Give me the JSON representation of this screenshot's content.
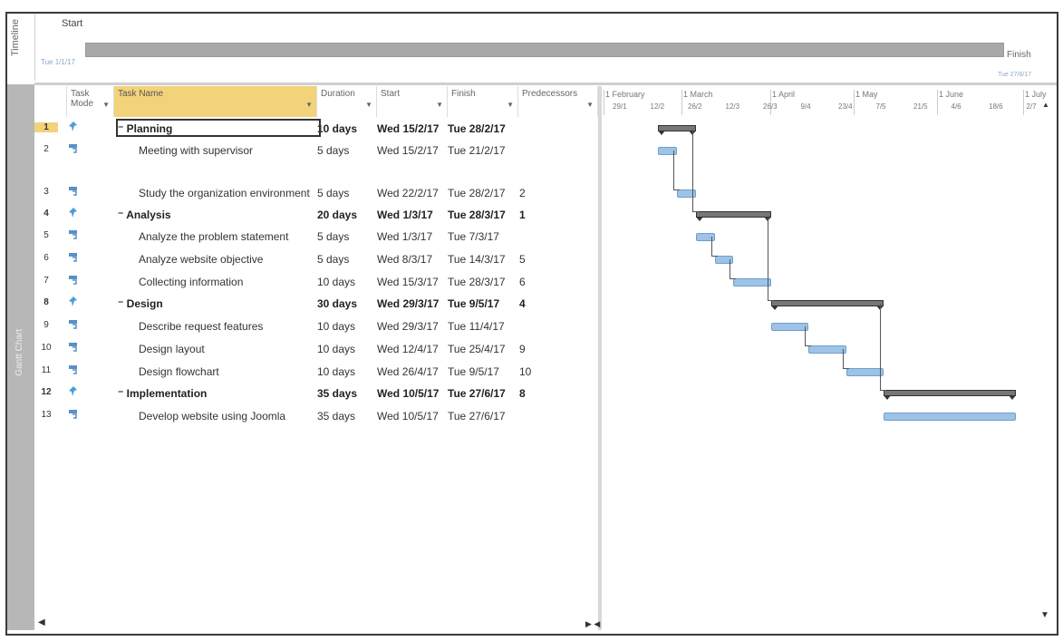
{
  "timeline": {
    "side_label": "Timeline",
    "start_label": "Start",
    "start_date": "Tue 1/1/17",
    "finish_label": "Finish",
    "finish_date": "Tue 27/6/17"
  },
  "gantt_side_label": "Gantt Chart",
  "columns": {
    "task_mode": "Task Mode",
    "task_name": "Task Name",
    "duration": "Duration",
    "start": "Start",
    "finish": "Finish",
    "predecessors": "Predecessors"
  },
  "timescale": {
    "months": [
      "1 February",
      "1 March",
      "1 April",
      "1 May",
      "1 June",
      "1 July"
    ],
    "weeks": [
      "29/1",
      "12/2",
      "26/2",
      "12/3",
      "26/3",
      "9/4",
      "23/4",
      "7/5",
      "21/5",
      "4/6",
      "18/6",
      "2/7"
    ]
  },
  "tasks": [
    {
      "id": "1",
      "name": "Planning",
      "duration": "10 days",
      "start": "Wed 15/2/17",
      "finish": "Tue 28/2/17",
      "pred": "",
      "summary": true,
      "mode": "manual"
    },
    {
      "id": "2",
      "name": "Meeting with supervisor",
      "duration": "5 days",
      "start": "Wed 15/2/17",
      "finish": "Tue 21/2/17",
      "pred": "",
      "summary": false,
      "mode": "auto"
    },
    {
      "id": "3",
      "name": "Study the organization environment",
      "duration": "5 days",
      "start": "Wed 22/2/17",
      "finish": "Tue 28/2/17",
      "pred": "2",
      "summary": false,
      "mode": "auto"
    },
    {
      "id": "4",
      "name": "Analysis",
      "duration": "20 days",
      "start": "Wed 1/3/17",
      "finish": "Tue 28/3/17",
      "pred": "1",
      "summary": true,
      "mode": "manual"
    },
    {
      "id": "5",
      "name": "Analyze the problem statement",
      "duration": "5 days",
      "start": "Wed 1/3/17",
      "finish": "Tue 7/3/17",
      "pred": "",
      "summary": false,
      "mode": "auto"
    },
    {
      "id": "6",
      "name": "Analyze  website objective",
      "duration": "5 days",
      "start": "Wed 8/3/17",
      "finish": "Tue 14/3/17",
      "pred": "5",
      "summary": false,
      "mode": "auto"
    },
    {
      "id": "7",
      "name": "Collecting information",
      "duration": "10 days",
      "start": "Wed 15/3/17",
      "finish": "Tue 28/3/17",
      "pred": "6",
      "summary": false,
      "mode": "auto"
    },
    {
      "id": "8",
      "name": "Design",
      "duration": "30 days",
      "start": "Wed 29/3/17",
      "finish": "Tue 9/5/17",
      "pred": "4",
      "summary": true,
      "mode": "manual"
    },
    {
      "id": "9",
      "name": "Describe request features",
      "duration": "10 days",
      "start": "Wed 29/3/17",
      "finish": "Tue 11/4/17",
      "pred": "",
      "summary": false,
      "mode": "auto"
    },
    {
      "id": "10",
      "name": "Design layout",
      "duration": "10 days",
      "start": "Wed 12/4/17",
      "finish": "Tue 25/4/17",
      "pred": "9",
      "summary": false,
      "mode": "auto"
    },
    {
      "id": "11",
      "name": "Design flowchart",
      "duration": "10 days",
      "start": "Wed 26/4/17",
      "finish": "Tue 9/5/17",
      "pred": "10",
      "summary": false,
      "mode": "auto"
    },
    {
      "id": "12",
      "name": "Implementation",
      "duration": "35 days",
      "start": "Wed 10/5/17",
      "finish": "Tue 27/6/17",
      "pred": "8",
      "summary": true,
      "mode": "manual"
    },
    {
      "id": "13",
      "name": "Develop website using Joomla",
      "duration": "35 days",
      "start": "Wed 10/5/17",
      "finish": "Tue 27/6/17",
      "pred": "",
      "summary": false,
      "mode": "auto"
    }
  ],
  "colors": {
    "selected_header": "#f3d37a",
    "task_bar": "#9dc3e6",
    "summary_bar": "#777777",
    "manual_pin": "#4a9fd8"
  }
}
